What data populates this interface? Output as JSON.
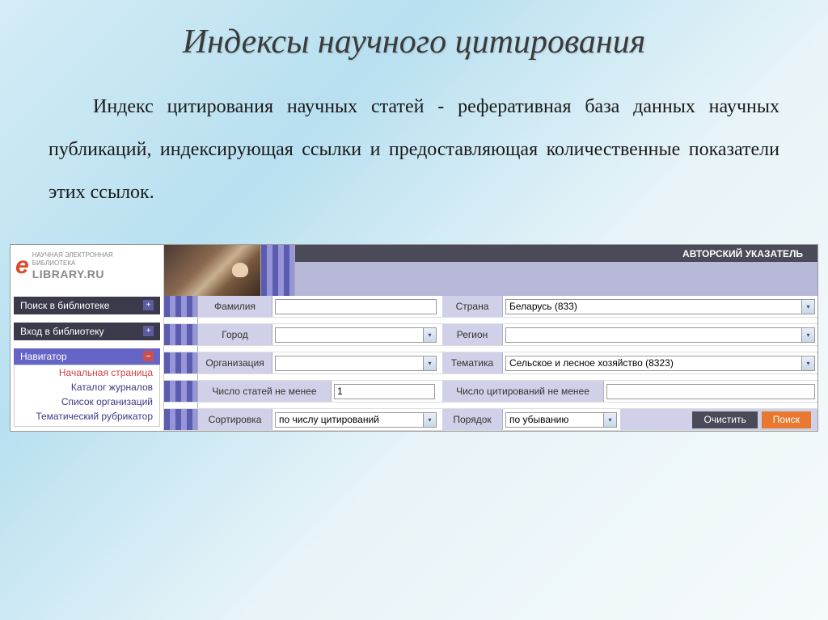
{
  "slide": {
    "title": "Индексы научного цитирования",
    "paragraph": "Индекс цитирования научных статей - реферативная база данных научных публикаций, индексирующая ссылки и предоставляющая количественные показатели этих ссылок."
  },
  "logo": {
    "top_line": "НАУЧНАЯ ЭЛЕКТРОННАЯ",
    "mid_line": "БИБЛИОТЕКА",
    "brand": "LIBRARY.RU"
  },
  "sidebar": {
    "search_btn": "Поиск в библиотеке",
    "login_btn": "Вход в библиотеку",
    "navigator": "Навигатор",
    "nav_items": [
      "Начальная страница",
      "Каталог журналов",
      "Список организаций",
      "Тематический рубрикатор"
    ]
  },
  "header": {
    "title": "АВТОРСКИЙ УКАЗАТЕЛЬ"
  },
  "form": {
    "surname_label": "Фамилия",
    "surname_value": "",
    "country_label": "Страна",
    "country_value": "Беларусь  (833)",
    "city_label": "Город",
    "city_value": "",
    "region_label": "Регион",
    "region_value": "",
    "org_label": "Организация",
    "org_value": "",
    "topic_label": "Тематика",
    "topic_value": "Сельское и лесное хозяйство  (8323)",
    "articles_min_label": "Число статей не менее",
    "articles_min_value": "1",
    "citations_min_label": "Число цитирований не менее",
    "citations_min_value": "",
    "sort_label": "Сортировка",
    "sort_value": "по числу цитирований",
    "order_label": "Порядок",
    "order_value": "по убыванию",
    "clear_btn": "Очистить",
    "search_btn": "Поиск"
  }
}
